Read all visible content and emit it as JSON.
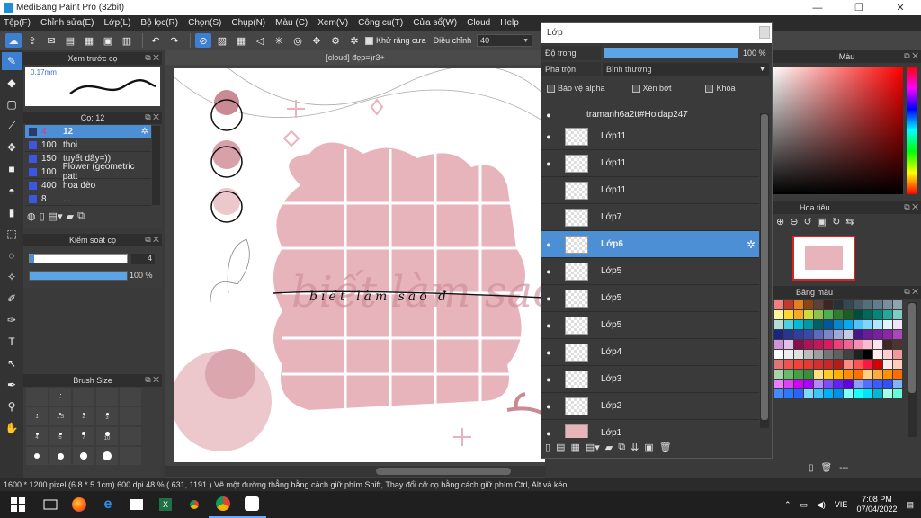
{
  "window": {
    "title": "MediBang Paint Pro (32bit)",
    "min": "—",
    "max": "❐",
    "close": "✕"
  },
  "menu": [
    "Tệp(F)",
    "Chỉnh sửa(E)",
    "Lớp(L)",
    "Bộ lọc(R)",
    "Chọn(S)",
    "Chụp(N)",
    "Màu (C)",
    "Xem(V)",
    "Công cụ(T)",
    "Cửa sổ(W)",
    "Cloud",
    "Help"
  ],
  "toolbar": {
    "antialias_label": "Khử răng cưa",
    "adjust_label": "Điều chỉnh",
    "adjust_value": "40"
  },
  "brush_preview": {
    "title": "Xem trước cọ",
    "size_label": "0.17mm"
  },
  "brush_panel": {
    "title": "Cọ: 12",
    "items": [
      {
        "size": "4",
        "name": "12",
        "selected": true
      },
      {
        "size": "100",
        "name": "thoi"
      },
      {
        "size": "150",
        "name": "tuyết dây=))"
      },
      {
        "size": "100",
        "name": "Flower (geometric patt"
      },
      {
        "size": "400",
        "name": "hoa đèo"
      },
      {
        "size": "8",
        "name": "..."
      }
    ]
  },
  "brush_control": {
    "title": "Kiểm soát cọ",
    "size_value": "4",
    "opacity_value": "100 %",
    "opacity_fraction": 1.0
  },
  "brush_size": {
    "title": "Brush Size",
    "labels": [
      "",
      ".",
      "",
      "",
      "",
      "1",
      "1.5",
      "2",
      "3",
      "",
      "4",
      "5",
      "7",
      "10",
      "",
      "",
      "",
      "",
      "",
      ""
    ]
  },
  "canvas": {
    "tab_title": "[cloud] đẹp=)r3+",
    "text_art": "biết làm sao đ"
  },
  "layer_panel": {
    "title": "Lớp",
    "opacity_label": "Độ trong",
    "opacity_value": "100 %",
    "opacity_fraction": 1.0,
    "blend_label": "Pha trộn",
    "blend_value": "Bình thường",
    "protect_alpha": "Bảo vệ alpha",
    "clipping": "Xén bớt",
    "lock": "Khóa",
    "layers": [
      {
        "name": "tramanh6a2tt#Hoidap247",
        "visible": true,
        "is_text": true
      },
      {
        "name": "Lớp11",
        "visible": true
      },
      {
        "name": "Lớp11",
        "visible": true
      },
      {
        "name": "Lớp11",
        "visible": false
      },
      {
        "name": "Lớp7",
        "visible": false
      },
      {
        "name": "Lớp6",
        "visible": true,
        "selected": true
      },
      {
        "name": "Lớp5",
        "visible": true
      },
      {
        "name": "Lớp5",
        "visible": true
      },
      {
        "name": "Lớp5",
        "visible": true
      },
      {
        "name": "Lớp4",
        "visible": true
      },
      {
        "name": "Lớp3",
        "visible": true
      },
      {
        "name": "Lớp2",
        "visible": true
      },
      {
        "name": "Lớp1",
        "visible": true
      }
    ]
  },
  "color_panel": {
    "title": "Màu"
  },
  "navigator_panel": {
    "title": "Hoa tiêu"
  },
  "palette_panel": {
    "title": "Bảng màu",
    "more": "---"
  },
  "status": {
    "text": "1600 * 1200 pixel   (6.8 * 5.1cm)  600 dpi   48 %   ( 631, 1191 )   Vẽ một đường thẳng bằng cách giữ phím Shift, Thay đổi cỡ cọ bằng cách giữ phím Ctrl, Alt và kéo"
  },
  "taskbar": {
    "lang": "VIE",
    "time": "7:08 PM",
    "date": "07/04/2022"
  },
  "colors": {
    "accent": "#4c8fd4",
    "pink": "#e8b4bc",
    "dark_pink": "#c98a93"
  }
}
